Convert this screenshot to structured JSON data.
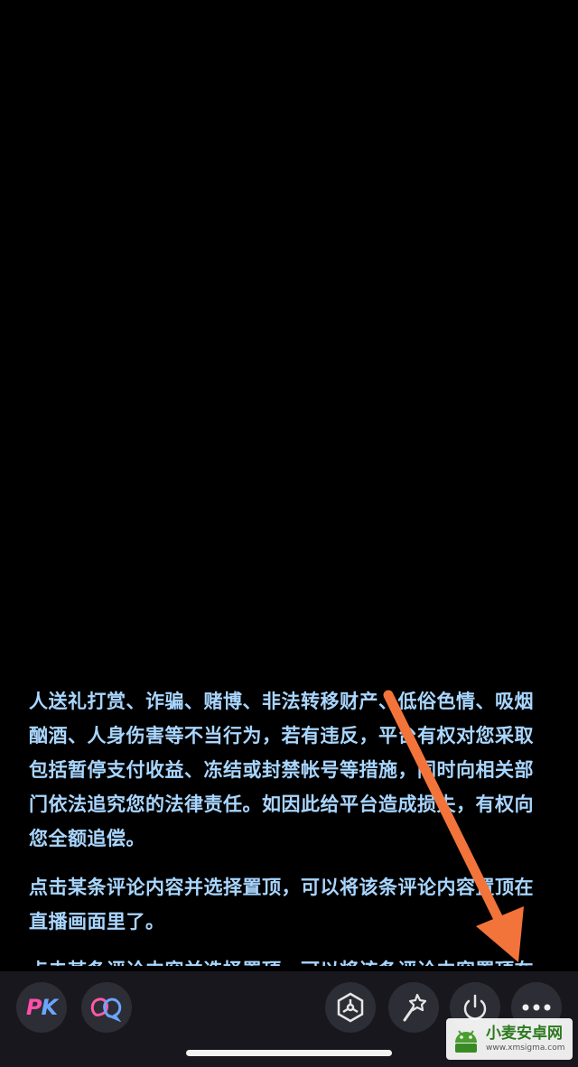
{
  "comments": [
    "人送礼打赏、诈骗、赌博、非法转移财产、低俗色情、吸烟酗酒、人身伤害等不当行为，若有违反，平台有权对您采取包括暂停支付收益、冻结或封禁帐号等措施，同时向相关部门依法追究您的法律责任。如因此给平台造成损失，有权向您全额追偿。",
    "点击某条评论内容并选择置顶，可以将该条评论内容置顶在直播画面里了。",
    "点击某条评论内容并选择置顶，可以将该条评论内容置顶在直播画面里了。"
  ],
  "toolbar": {
    "pk_p": "P",
    "pk_k": "K",
    "icons": [
      "pk-icon",
      "link-mic-icon",
      "interaction-icon",
      "beauty-wand-icon",
      "power-icon",
      "more-icon"
    ]
  },
  "watermark": {
    "title": "小麦安卓网",
    "url": "www.xmsigma.com"
  },
  "colors": {
    "comment_text": "#a9d6ff",
    "toolbar_bg": "#17171d",
    "button_bg": "#2d2d35",
    "arrow": "#f2743a",
    "pk_pink": "#ff4fa8",
    "pk_blue": "#6aa6ff"
  }
}
